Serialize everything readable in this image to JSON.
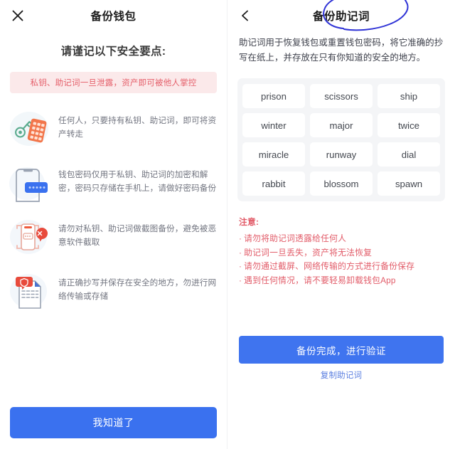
{
  "left_screen": {
    "close_icon": "close-icon",
    "title": "备份钱包",
    "heading": "请谨记以下安全要点:",
    "alert": "私钥、助记词一旦泄露，资产即可被他人掌控",
    "tips": [
      {
        "icon": "key-and-keypad-icon",
        "text": "任何人，只要持有私钥、助记词，即可将资产转走"
      },
      {
        "icon": "phone-password-icon",
        "text": "钱包密码仅用于私钥、助记词的加密和解密，密码只存储在手机上，请做好密码备份"
      },
      {
        "icon": "no-screenshot-icon",
        "text": "请勿对私钥、助记词做截图备份，避免被恶意软件截取"
      },
      {
        "icon": "document-shield-icon",
        "text": "请正确抄写并保存在安全的地方，勿进行网络传输或存储"
      }
    ],
    "confirm_button": "我知道了"
  },
  "right_screen": {
    "back_icon": "chevron-left-icon",
    "title": "备份助记词",
    "annotation": "hand-drawn-circle-annotation",
    "intro": "助记词用于恢复钱包或重置钱包密码，将它准确的抄写在纸上，并存放在只有你知道的安全的地方。",
    "mnemonic_words": [
      "prison",
      "scissors",
      "ship",
      "winter",
      "major",
      "twice",
      "miracle",
      "runway",
      "dial",
      "rabbit",
      "blossom",
      "spawn"
    ],
    "notes_title": "注意:",
    "notes": [
      "请勿将助记词透露给任何人",
      "助记词一旦丢失，资产将无法恢复",
      "请勿通过截屏、网络传输的方式进行备份保存",
      "遇到任何情况，请不要轻易卸载钱包App"
    ],
    "note_bullet": "·",
    "cta_button": "备份完成，进行验证",
    "copy_link": "复制助记词"
  },
  "colors": {
    "primary_blue": "#3a71ef",
    "alert_pink_bg": "#fbe9ea",
    "alert_red_text": "#e25c69",
    "chip_bg": "#f4f5f7",
    "annotation_blue": "#2f33d6"
  }
}
